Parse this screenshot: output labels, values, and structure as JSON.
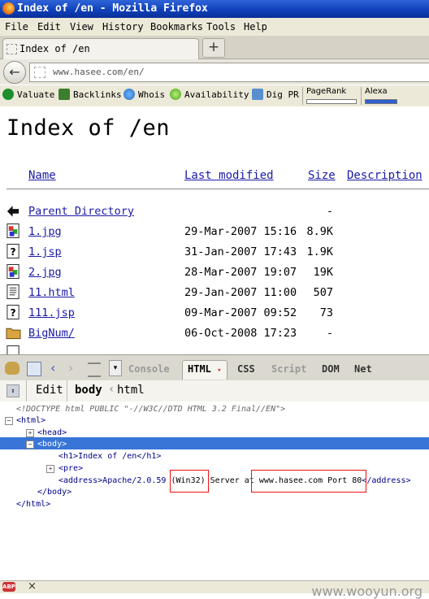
{
  "window": {
    "title": "Index of /en - Mozilla Firefox"
  },
  "menu": [
    "File",
    "Edit",
    "View",
    "History",
    "Bookmarks",
    "Tools",
    "Help"
  ],
  "tab": {
    "title": "Index of /en",
    "new_tab": "+"
  },
  "nav": {
    "url": "www.hasee.com/en/"
  },
  "toolbar": {
    "valuate": "Valuate",
    "backlinks": "Backlinks",
    "whois": "Whois",
    "availability": "Availability",
    "digpr": "Dig PR",
    "pagerank": "PageRank",
    "alexa": "Alexa"
  },
  "page": {
    "heading": "Index of /en",
    "columns": {
      "name": "Name",
      "modified": "Last modified",
      "size": "Size",
      "description": "Description"
    },
    "rows": [
      {
        "name": "Parent Directory",
        "date": "",
        "size": "-",
        "icon": "back-icon"
      },
      {
        "name": "1.jpg",
        "date": "29-Mar-2007 15:16",
        "size": "8.9K",
        "icon": "image-icon"
      },
      {
        "name": "1.jsp",
        "date": "31-Jan-2007 17:43",
        "size": "1.9K",
        "icon": "unknown-file-icon"
      },
      {
        "name": "2.jpg",
        "date": "28-Mar-2007 19:07",
        "size": "19K",
        "icon": "image-icon"
      },
      {
        "name": "11.html",
        "date": "29-Jan-2007 11:00",
        "size": "507",
        "icon": "text-file-icon"
      },
      {
        "name": "111.jsp",
        "date": "09-Mar-2007 09:52",
        "size": "73",
        "icon": "unknown-file-icon"
      },
      {
        "name": "BigNum/",
        "date": "06-Oct-2008 17:23",
        "size": "-",
        "icon": "folder-icon"
      }
    ]
  },
  "firebug": {
    "tabs": {
      "console": "Console",
      "html": "HTML",
      "css": "CSS",
      "script": "Script",
      "dom": "DOM",
      "net": "Net"
    },
    "edit": "Edit",
    "breadcrumb_current": "body",
    "breadcrumb_parent": "html",
    "doctype": "<!DOCTYPE html PUBLIC \"-//W3C//DTD HTML 3.2 Final//EN\">",
    "html_open": "<html>",
    "head": "<head>",
    "body_open": "<body>",
    "h1": "<h1>Index of /en</h1>",
    "pre": "<pre>",
    "address_1": "<address>Apache/2.0.59 ",
    "address_win": "(Win32)",
    "address_2": " Server at ",
    "address_host": "www.hasee.com Port 80",
    "address_3": "</address>",
    "body_close": "</body>",
    "html_close": "</html>"
  },
  "status": {
    "watermark": "www.wooyun.org"
  }
}
